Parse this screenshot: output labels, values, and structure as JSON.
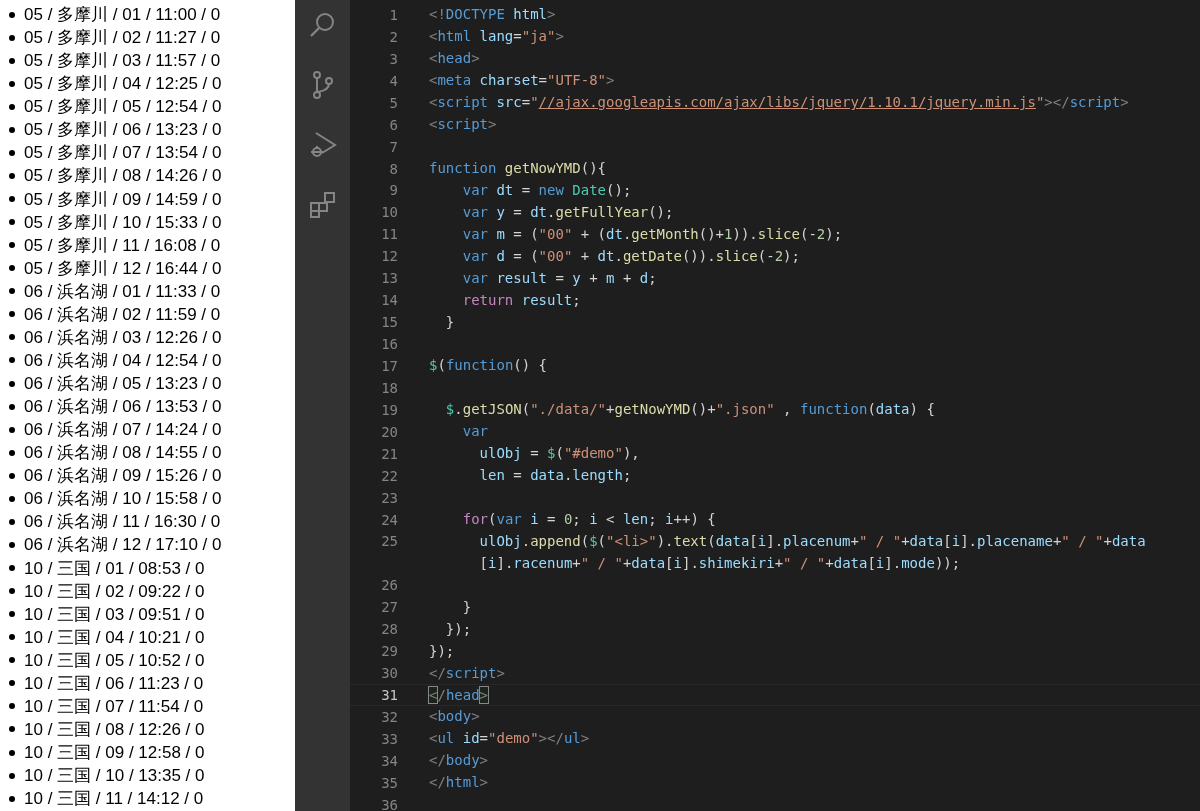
{
  "result_list": [
    "05 / 多摩川 / 01 / 11:00 / 0",
    "05 / 多摩川 / 02 / 11:27 / 0",
    "05 / 多摩川 / 03 / 11:57 / 0",
    "05 / 多摩川 / 04 / 12:25 / 0",
    "05 / 多摩川 / 05 / 12:54 / 0",
    "05 / 多摩川 / 06 / 13:23 / 0",
    "05 / 多摩川 / 07 / 13:54 / 0",
    "05 / 多摩川 / 08 / 14:26 / 0",
    "05 / 多摩川 / 09 / 14:59 / 0",
    "05 / 多摩川 / 10 / 15:33 / 0",
    "05 / 多摩川 / 11 / 16:08 / 0",
    "05 / 多摩川 / 12 / 16:44 / 0",
    "06 / 浜名湖 / 01 / 11:33 / 0",
    "06 / 浜名湖 / 02 / 11:59 / 0",
    "06 / 浜名湖 / 03 / 12:26 / 0",
    "06 / 浜名湖 / 04 / 12:54 / 0",
    "06 / 浜名湖 / 05 / 13:23 / 0",
    "06 / 浜名湖 / 06 / 13:53 / 0",
    "06 / 浜名湖 / 07 / 14:24 / 0",
    "06 / 浜名湖 / 08 / 14:55 / 0",
    "06 / 浜名湖 / 09 / 15:26 / 0",
    "06 / 浜名湖 / 10 / 15:58 / 0",
    "06 / 浜名湖 / 11 / 16:30 / 0",
    "06 / 浜名湖 / 12 / 17:10 / 0",
    "10 / 三国 / 01 / 08:53 / 0",
    "10 / 三国 / 02 / 09:22 / 0",
    "10 / 三国 / 03 / 09:51 / 0",
    "10 / 三国 / 04 / 10:21 / 0",
    "10 / 三国 / 05 / 10:52 / 0",
    "10 / 三国 / 06 / 11:23 / 0",
    "10 / 三国 / 07 / 11:54 / 0",
    "10 / 三国 / 08 / 12:26 / 0",
    "10 / 三国 / 09 / 12:58 / 0",
    "10 / 三国 / 10 / 13:35 / 0",
    "10 / 三国 / 11 / 14:12 / 0"
  ],
  "activity_bar": [
    {
      "kind": "search"
    },
    {
      "kind": "source-control"
    },
    {
      "kind": "run-debug"
    },
    {
      "kind": "extensions"
    }
  ],
  "editor": {
    "lines": [
      {
        "num": "1",
        "current": false,
        "tokens": [
          {
            "kind": "tp",
            "text": "<!"
          },
          {
            "kind": "tag",
            "text": "DOCTYPE"
          },
          {
            "kind": "attr",
            "text": " html"
          },
          {
            "kind": "tp",
            "text": ">"
          }
        ]
      },
      {
        "num": "2",
        "current": false,
        "tokens": [
          {
            "kind": "tp",
            "text": "<"
          },
          {
            "kind": "tag",
            "text": "html"
          },
          {
            "kind": "attr",
            "text": " lang"
          },
          {
            "kind": "p",
            "text": "="
          },
          {
            "kind": "str",
            "text": "\"ja\""
          },
          {
            "kind": "tp",
            "text": ">"
          }
        ]
      },
      {
        "num": "3",
        "current": false,
        "tokens": [
          {
            "kind": "tp",
            "text": "<"
          },
          {
            "kind": "tag",
            "text": "head"
          },
          {
            "kind": "tp",
            "text": ">"
          }
        ]
      },
      {
        "num": "4",
        "current": false,
        "tokens": [
          {
            "kind": "tp",
            "text": "<"
          },
          {
            "kind": "tag",
            "text": "meta"
          },
          {
            "kind": "attr",
            "text": " charset"
          },
          {
            "kind": "p",
            "text": "="
          },
          {
            "kind": "str",
            "text": "\"UTF-8\""
          },
          {
            "kind": "tp",
            "text": ">"
          }
        ]
      },
      {
        "num": "5",
        "current": false,
        "tokens": [
          {
            "kind": "tp",
            "text": "<"
          },
          {
            "kind": "tag",
            "text": "script"
          },
          {
            "kind": "attr",
            "text": " src"
          },
          {
            "kind": "p",
            "text": "="
          },
          {
            "kind": "str",
            "text": "\""
          },
          {
            "kind": "link",
            "text": "//ajax.googleapis.com/ajax/libs/jquery/1.10.1/jquery.min.js"
          },
          {
            "kind": "str",
            "text": "\""
          },
          {
            "kind": "tp",
            "text": "></"
          },
          {
            "kind": "tag",
            "text": "script"
          },
          {
            "kind": "tp",
            "text": ">"
          }
        ]
      },
      {
        "num": "6",
        "current": false,
        "tokens": [
          {
            "kind": "tp",
            "text": "<"
          },
          {
            "kind": "tag",
            "text": "script"
          },
          {
            "kind": "tp",
            "text": ">"
          }
        ]
      },
      {
        "num": "7",
        "current": false
      },
      {
        "num": "8",
        "current": false,
        "tokens": [
          {
            "kind": "kw",
            "text": "function"
          },
          {
            "kind": "fn",
            "text": " getNowYMD"
          },
          {
            "kind": "p",
            "text": "(){"
          }
        ]
      },
      {
        "num": "9",
        "current": false,
        "tokens": [
          {
            "kind": "kw",
            "text": "    var"
          },
          {
            "kind": "var",
            "text": " dt"
          },
          {
            "kind": "p",
            "text": " = "
          },
          {
            "kind": "kw",
            "text": "new"
          },
          {
            "kind": "type",
            "text": " Date"
          },
          {
            "kind": "p",
            "text": "();"
          }
        ]
      },
      {
        "num": "10",
        "current": false,
        "tokens": [
          {
            "kind": "kw",
            "text": "    var"
          },
          {
            "kind": "var",
            "text": " y"
          },
          {
            "kind": "p",
            "text": " = "
          },
          {
            "kind": "var",
            "text": "dt"
          },
          {
            "kind": "p",
            "text": "."
          },
          {
            "kind": "fn",
            "text": "getFullYear"
          },
          {
            "kind": "p",
            "text": "();"
          }
        ]
      },
      {
        "num": "11",
        "current": false,
        "tokens": [
          {
            "kind": "kw",
            "text": "    var"
          },
          {
            "kind": "var",
            "text": " m"
          },
          {
            "kind": "p",
            "text": " = ("
          },
          {
            "kind": "str",
            "text": "\"00\""
          },
          {
            "kind": "p",
            "text": " + ("
          },
          {
            "kind": "var",
            "text": "dt"
          },
          {
            "kind": "p",
            "text": "."
          },
          {
            "kind": "fn",
            "text": "getMonth"
          },
          {
            "kind": "p",
            "text": "()+"
          },
          {
            "kind": "num",
            "text": "1"
          },
          {
            "kind": "p",
            "text": "))."
          },
          {
            "kind": "fn",
            "text": "slice"
          },
          {
            "kind": "p",
            "text": "(-"
          },
          {
            "kind": "num",
            "text": "2"
          },
          {
            "kind": "p",
            "text": ");"
          }
        ]
      },
      {
        "num": "12",
        "current": false,
        "tokens": [
          {
            "kind": "kw",
            "text": "    var"
          },
          {
            "kind": "var",
            "text": " d"
          },
          {
            "kind": "p",
            "text": " = ("
          },
          {
            "kind": "str",
            "text": "\"00\""
          },
          {
            "kind": "p",
            "text": " + "
          },
          {
            "kind": "var",
            "text": "dt"
          },
          {
            "kind": "p",
            "text": "."
          },
          {
            "kind": "fn",
            "text": "getDate"
          },
          {
            "kind": "p",
            "text": "())."
          },
          {
            "kind": "fn",
            "text": "slice"
          },
          {
            "kind": "p",
            "text": "(-"
          },
          {
            "kind": "num",
            "text": "2"
          },
          {
            "kind": "p",
            "text": ");"
          }
        ]
      },
      {
        "num": "13",
        "current": false,
        "tokens": [
          {
            "kind": "kw",
            "text": "    var"
          },
          {
            "kind": "var",
            "text": " result"
          },
          {
            "kind": "p",
            "text": " = "
          },
          {
            "kind": "var",
            "text": "y"
          },
          {
            "kind": "p",
            "text": " + "
          },
          {
            "kind": "var",
            "text": "m"
          },
          {
            "kind": "p",
            "text": " + "
          },
          {
            "kind": "var",
            "text": "d"
          },
          {
            "kind": "p",
            "text": ";"
          }
        ]
      },
      {
        "num": "14",
        "current": false,
        "tokens": [
          {
            "kind": "ctl",
            "text": "    return"
          },
          {
            "kind": "var",
            "text": " result"
          },
          {
            "kind": "p",
            "text": ";"
          }
        ]
      },
      {
        "num": "15",
        "current": false,
        "tokens": [
          {
            "kind": "p",
            "text": "  }"
          }
        ]
      },
      {
        "num": "16",
        "current": false
      },
      {
        "num": "17",
        "current": false,
        "tokens": [
          {
            "kind": "type",
            "text": "$"
          },
          {
            "kind": "p",
            "text": "("
          },
          {
            "kind": "kw",
            "text": "function"
          },
          {
            "kind": "p",
            "text": "() {"
          }
        ]
      },
      {
        "num": "18",
        "current": false
      },
      {
        "num": "19",
        "current": false,
        "tokens": [
          {
            "kind": "type",
            "text": "  $"
          },
          {
            "kind": "p",
            "text": "."
          },
          {
            "kind": "fn",
            "text": "getJSON"
          },
          {
            "kind": "p",
            "text": "("
          },
          {
            "kind": "str",
            "text": "\"./data/\""
          },
          {
            "kind": "p",
            "text": "+"
          },
          {
            "kind": "fn",
            "text": "getNowYMD"
          },
          {
            "kind": "p",
            "text": "()+"
          },
          {
            "kind": "str",
            "text": "\".json\""
          },
          {
            "kind": "p",
            "text": " , "
          },
          {
            "kind": "kw",
            "text": "function"
          },
          {
            "kind": "p",
            "text": "("
          },
          {
            "kind": "var",
            "text": "data"
          },
          {
            "kind": "p",
            "text": ") {"
          }
        ]
      },
      {
        "num": "20",
        "current": false,
        "tokens": [
          {
            "kind": "kw",
            "text": "    var"
          }
        ]
      },
      {
        "num": "21",
        "current": false,
        "tokens": [
          {
            "kind": "var",
            "text": "      ulObj"
          },
          {
            "kind": "p",
            "text": " = "
          },
          {
            "kind": "type",
            "text": "$"
          },
          {
            "kind": "p",
            "text": "("
          },
          {
            "kind": "str",
            "text": "\"#demo\""
          },
          {
            "kind": "p",
            "text": "),"
          }
        ]
      },
      {
        "num": "22",
        "current": false,
        "tokens": [
          {
            "kind": "var",
            "text": "      len"
          },
          {
            "kind": "p",
            "text": " = "
          },
          {
            "kind": "var",
            "text": "data"
          },
          {
            "kind": "p",
            "text": "."
          },
          {
            "kind": "var",
            "text": "length"
          },
          {
            "kind": "p",
            "text": ";"
          }
        ]
      },
      {
        "num": "23",
        "current": false
      },
      {
        "num": "24",
        "current": false,
        "tokens": [
          {
            "kind": "ctl",
            "text": "    for"
          },
          {
            "kind": "p",
            "text": "("
          },
          {
            "kind": "kw",
            "text": "var"
          },
          {
            "kind": "var",
            "text": " i"
          },
          {
            "kind": "p",
            "text": " = "
          },
          {
            "kind": "num",
            "text": "0"
          },
          {
            "kind": "p",
            "text": "; "
          },
          {
            "kind": "var",
            "text": "i"
          },
          {
            "kind": "p",
            "text": " < "
          },
          {
            "kind": "var",
            "text": "len"
          },
          {
            "kind": "p",
            "text": "; "
          },
          {
            "kind": "var",
            "text": "i"
          },
          {
            "kind": "p",
            "text": "++) {"
          }
        ]
      },
      {
        "num": "25",
        "current": false,
        "tokens": [
          {
            "kind": "var",
            "text": "      ulObj"
          },
          {
            "kind": "p",
            "text": "."
          },
          {
            "kind": "fn",
            "text": "append"
          },
          {
            "kind": "p",
            "text": "("
          },
          {
            "kind": "type",
            "text": "$"
          },
          {
            "kind": "p",
            "text": "("
          },
          {
            "kind": "str",
            "text": "\"<li>\""
          },
          {
            "kind": "p",
            "text": ")."
          },
          {
            "kind": "fn",
            "text": "text"
          },
          {
            "kind": "p",
            "text": "("
          },
          {
            "kind": "var",
            "text": "data"
          },
          {
            "kind": "p",
            "text": "["
          },
          {
            "kind": "var",
            "text": "i"
          },
          {
            "kind": "p",
            "text": "]."
          },
          {
            "kind": "var",
            "text": "placenum"
          },
          {
            "kind": "p",
            "text": "+"
          },
          {
            "kind": "str",
            "text": "\" / \""
          },
          {
            "kind": "p",
            "text": "+"
          },
          {
            "kind": "var",
            "text": "data"
          },
          {
            "kind": "p",
            "text": "["
          },
          {
            "kind": "var",
            "text": "i"
          },
          {
            "kind": "p",
            "text": "]."
          },
          {
            "kind": "var",
            "text": "placename"
          },
          {
            "kind": "p",
            "text": "+"
          },
          {
            "kind": "str",
            "text": "\" / \""
          },
          {
            "kind": "p",
            "text": "+"
          },
          {
            "kind": "var",
            "text": "data"
          }
        ],
        "wrap": [
          {
            "kind": "p",
            "text": "      ["
          },
          {
            "kind": "var",
            "text": "i"
          },
          {
            "kind": "p",
            "text": "]."
          },
          {
            "kind": "var",
            "text": "racenum"
          },
          {
            "kind": "p",
            "text": "+"
          },
          {
            "kind": "str",
            "text": "\" / \""
          },
          {
            "kind": "p",
            "text": "+"
          },
          {
            "kind": "var",
            "text": "data"
          },
          {
            "kind": "p",
            "text": "["
          },
          {
            "kind": "var",
            "text": "i"
          },
          {
            "kind": "p",
            "text": "]."
          },
          {
            "kind": "var",
            "text": "shimekiri"
          },
          {
            "kind": "p",
            "text": "+"
          },
          {
            "kind": "str",
            "text": "\" / \""
          },
          {
            "kind": "p",
            "text": "+"
          },
          {
            "kind": "var",
            "text": "data"
          },
          {
            "kind": "p",
            "text": "["
          },
          {
            "kind": "var",
            "text": "i"
          },
          {
            "kind": "p",
            "text": "]."
          },
          {
            "kind": "var",
            "text": "mode"
          },
          {
            "kind": "p",
            "text": "));"
          }
        ]
      },
      {
        "num": "26",
        "current": false
      },
      {
        "num": "27",
        "current": false,
        "tokens": [
          {
            "kind": "p",
            "text": "    }"
          }
        ]
      },
      {
        "num": "28",
        "current": false,
        "tokens": [
          {
            "kind": "p",
            "text": "  });"
          }
        ]
      },
      {
        "num": "29",
        "current": false,
        "tokens": [
          {
            "kind": "p",
            "text": "});"
          }
        ]
      },
      {
        "num": "30",
        "current": false,
        "tokens": [
          {
            "kind": "tp",
            "text": "</"
          },
          {
            "kind": "tag",
            "text": "script"
          },
          {
            "kind": "tp",
            "text": ">"
          }
        ]
      },
      {
        "num": "31",
        "current": true,
        "tokens": [
          {
            "kind": "match",
            "text": "<"
          },
          {
            "kind": "tp",
            "text": "/"
          },
          {
            "kind": "tag",
            "text": "head"
          },
          {
            "kind": "match",
            "text": ">"
          }
        ]
      },
      {
        "num": "32",
        "current": false,
        "tokens": [
          {
            "kind": "tp",
            "text": "<"
          },
          {
            "kind": "tag",
            "text": "body"
          },
          {
            "kind": "tp",
            "text": ">"
          }
        ]
      },
      {
        "num": "33",
        "current": false,
        "tokens": [
          {
            "kind": "tp",
            "text": "<"
          },
          {
            "kind": "tag",
            "text": "ul"
          },
          {
            "kind": "attr",
            "text": " id"
          },
          {
            "kind": "p",
            "text": "="
          },
          {
            "kind": "str",
            "text": "\"demo\""
          },
          {
            "kind": "tp",
            "text": "></"
          },
          {
            "kind": "tag",
            "text": "ul"
          },
          {
            "kind": "tp",
            "text": ">"
          }
        ]
      },
      {
        "num": "34",
        "current": false,
        "tokens": [
          {
            "kind": "tp",
            "text": "</"
          },
          {
            "kind": "tag",
            "text": "body"
          },
          {
            "kind": "tp",
            "text": ">"
          }
        ]
      },
      {
        "num": "35",
        "current": false,
        "tokens": [
          {
            "kind": "tp",
            "text": "</"
          },
          {
            "kind": "tag",
            "text": "html"
          },
          {
            "kind": "tp",
            "text": ">"
          }
        ]
      },
      {
        "num": "36",
        "current": false
      }
    ]
  }
}
